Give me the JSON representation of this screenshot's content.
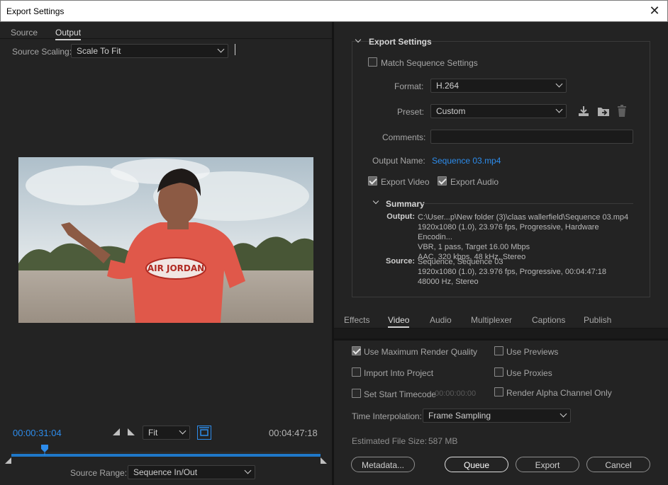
{
  "window": {
    "title": "Export Settings"
  },
  "left": {
    "tabs": [
      {
        "label": "Source"
      },
      {
        "label": "Output"
      }
    ],
    "source_scaling": {
      "label": "Source Scaling:",
      "value": "Scale To Fit"
    },
    "video": {
      "shirt_text": "AIR JORDAN",
      "colors": {
        "sky": "#c9d5dc",
        "ground": "#a69b8e",
        "shirt": "#e15746",
        "trees": "#4b5a3a"
      }
    },
    "timecode_current": "00:00:31:04",
    "timecode_total": "00:04:47:18",
    "zoom": {
      "value": "Fit"
    },
    "source_range": {
      "label": "Source Range:",
      "value": "Sequence In/Out"
    },
    "playhead_fraction": 0.107
  },
  "export_settings": {
    "title": "Export Settings",
    "match_sequence": {
      "label": "Match Sequence Settings",
      "checked": false
    },
    "format": {
      "label": "Format:",
      "value": "H.264"
    },
    "preset": {
      "label": "Preset:",
      "value": "Custom"
    },
    "comments": {
      "label": "Comments:",
      "value": ""
    },
    "output_name": {
      "label": "Output Name:",
      "value": "Sequence 03.mp4"
    },
    "export_video": {
      "label": "Export Video",
      "checked": true
    },
    "export_audio": {
      "label": "Export Audio",
      "checked": true
    },
    "summary": {
      "title": "Summary",
      "output_label": "Output:",
      "output_lines": [
        "C:\\User...p\\New folder (3)\\claas wallerfield\\Sequence 03.mp4",
        "1920x1080 (1.0), 23.976 fps, Progressive, Hardware Encodin...",
        "VBR, 1 pass, Target 16.00 Mbps",
        "AAC, 320 kbps, 48 kHz, Stereo"
      ],
      "source_label": "Source:",
      "source_lines": [
        "Sequence, Sequence 03",
        "1920x1080 (1.0), 23.976 fps, Progressive, 00:04:47:18",
        "48000 Hz, Stereo"
      ]
    }
  },
  "settings_tabs": [
    {
      "label": "Effects"
    },
    {
      "label": "Video"
    },
    {
      "label": "Audio"
    },
    {
      "label": "Multiplexer"
    },
    {
      "label": "Captions"
    },
    {
      "label": "Publish"
    }
  ],
  "options": {
    "max_render_quality": {
      "label": "Use Maximum Render Quality",
      "checked": true
    },
    "use_previews": {
      "label": "Use Previews",
      "checked": false
    },
    "import_project": {
      "label": "Import Into Project",
      "checked": false
    },
    "use_proxies": {
      "label": "Use Proxies",
      "checked": false
    },
    "set_start_timecode": {
      "label": "Set Start Timecode",
      "checked": false,
      "value": "00:00:00:00"
    },
    "render_alpha": {
      "label": "Render Alpha Channel Only",
      "checked": false
    }
  },
  "time_interpolation": {
    "label": "Time Interpolation:",
    "value": "Frame Sampling"
  },
  "file_size": {
    "label": "Estimated File Size:",
    "value": "587 MB"
  },
  "buttons": {
    "metadata": "Metadata...",
    "queue": "Queue",
    "export": "Export",
    "cancel": "Cancel"
  },
  "colors": {
    "accent": "#2d8ceb",
    "timeline": "#1f78c8"
  }
}
